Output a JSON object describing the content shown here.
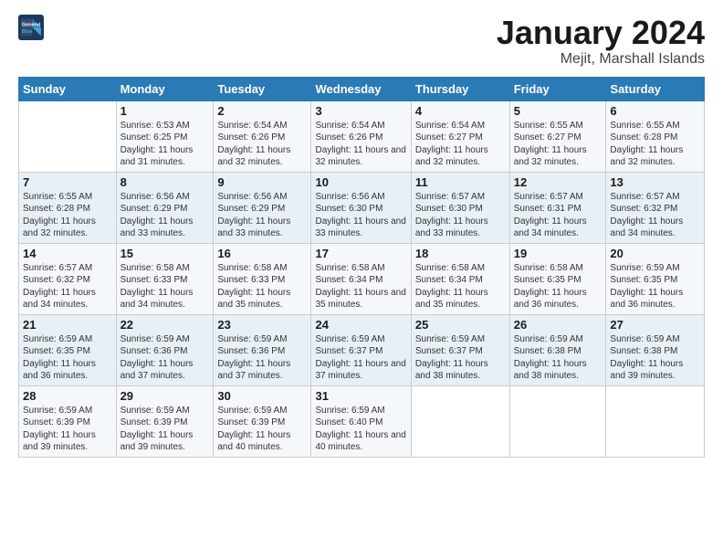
{
  "logo": {
    "line1": "General",
    "line2": "Blue"
  },
  "title": "January 2024",
  "subtitle": "Mejit, Marshall Islands",
  "columns": [
    "Sunday",
    "Monday",
    "Tuesday",
    "Wednesday",
    "Thursday",
    "Friday",
    "Saturday"
  ],
  "weeks": [
    [
      {
        "num": "",
        "sunrise": "",
        "sunset": "",
        "daylight": ""
      },
      {
        "num": "1",
        "sunrise": "Sunrise: 6:53 AM",
        "sunset": "Sunset: 6:25 PM",
        "daylight": "Daylight: 11 hours and 31 minutes."
      },
      {
        "num": "2",
        "sunrise": "Sunrise: 6:54 AM",
        "sunset": "Sunset: 6:26 PM",
        "daylight": "Daylight: 11 hours and 32 minutes."
      },
      {
        "num": "3",
        "sunrise": "Sunrise: 6:54 AM",
        "sunset": "Sunset: 6:26 PM",
        "daylight": "Daylight: 11 hours and 32 minutes."
      },
      {
        "num": "4",
        "sunrise": "Sunrise: 6:54 AM",
        "sunset": "Sunset: 6:27 PM",
        "daylight": "Daylight: 11 hours and 32 minutes."
      },
      {
        "num": "5",
        "sunrise": "Sunrise: 6:55 AM",
        "sunset": "Sunset: 6:27 PM",
        "daylight": "Daylight: 11 hours and 32 minutes."
      },
      {
        "num": "6",
        "sunrise": "Sunrise: 6:55 AM",
        "sunset": "Sunset: 6:28 PM",
        "daylight": "Daylight: 11 hours and 32 minutes."
      }
    ],
    [
      {
        "num": "7",
        "sunrise": "Sunrise: 6:55 AM",
        "sunset": "Sunset: 6:28 PM",
        "daylight": "Daylight: 11 hours and 32 minutes."
      },
      {
        "num": "8",
        "sunrise": "Sunrise: 6:56 AM",
        "sunset": "Sunset: 6:29 PM",
        "daylight": "Daylight: 11 hours and 33 minutes."
      },
      {
        "num": "9",
        "sunrise": "Sunrise: 6:56 AM",
        "sunset": "Sunset: 6:29 PM",
        "daylight": "Daylight: 11 hours and 33 minutes."
      },
      {
        "num": "10",
        "sunrise": "Sunrise: 6:56 AM",
        "sunset": "Sunset: 6:30 PM",
        "daylight": "Daylight: 11 hours and 33 minutes."
      },
      {
        "num": "11",
        "sunrise": "Sunrise: 6:57 AM",
        "sunset": "Sunset: 6:30 PM",
        "daylight": "Daylight: 11 hours and 33 minutes."
      },
      {
        "num": "12",
        "sunrise": "Sunrise: 6:57 AM",
        "sunset": "Sunset: 6:31 PM",
        "daylight": "Daylight: 11 hours and 34 minutes."
      },
      {
        "num": "13",
        "sunrise": "Sunrise: 6:57 AM",
        "sunset": "Sunset: 6:32 PM",
        "daylight": "Daylight: 11 hours and 34 minutes."
      }
    ],
    [
      {
        "num": "14",
        "sunrise": "Sunrise: 6:57 AM",
        "sunset": "Sunset: 6:32 PM",
        "daylight": "Daylight: 11 hours and 34 minutes."
      },
      {
        "num": "15",
        "sunrise": "Sunrise: 6:58 AM",
        "sunset": "Sunset: 6:33 PM",
        "daylight": "Daylight: 11 hours and 34 minutes."
      },
      {
        "num": "16",
        "sunrise": "Sunrise: 6:58 AM",
        "sunset": "Sunset: 6:33 PM",
        "daylight": "Daylight: 11 hours and 35 minutes."
      },
      {
        "num": "17",
        "sunrise": "Sunrise: 6:58 AM",
        "sunset": "Sunset: 6:34 PM",
        "daylight": "Daylight: 11 hours and 35 minutes."
      },
      {
        "num": "18",
        "sunrise": "Sunrise: 6:58 AM",
        "sunset": "Sunset: 6:34 PM",
        "daylight": "Daylight: 11 hours and 35 minutes."
      },
      {
        "num": "19",
        "sunrise": "Sunrise: 6:58 AM",
        "sunset": "Sunset: 6:35 PM",
        "daylight": "Daylight: 11 hours and 36 minutes."
      },
      {
        "num": "20",
        "sunrise": "Sunrise: 6:59 AM",
        "sunset": "Sunset: 6:35 PM",
        "daylight": "Daylight: 11 hours and 36 minutes."
      }
    ],
    [
      {
        "num": "21",
        "sunrise": "Sunrise: 6:59 AM",
        "sunset": "Sunset: 6:35 PM",
        "daylight": "Daylight: 11 hours and 36 minutes."
      },
      {
        "num": "22",
        "sunrise": "Sunrise: 6:59 AM",
        "sunset": "Sunset: 6:36 PM",
        "daylight": "Daylight: 11 hours and 37 minutes."
      },
      {
        "num": "23",
        "sunrise": "Sunrise: 6:59 AM",
        "sunset": "Sunset: 6:36 PM",
        "daylight": "Daylight: 11 hours and 37 minutes."
      },
      {
        "num": "24",
        "sunrise": "Sunrise: 6:59 AM",
        "sunset": "Sunset: 6:37 PM",
        "daylight": "Daylight: 11 hours and 37 minutes."
      },
      {
        "num": "25",
        "sunrise": "Sunrise: 6:59 AM",
        "sunset": "Sunset: 6:37 PM",
        "daylight": "Daylight: 11 hours and 38 minutes."
      },
      {
        "num": "26",
        "sunrise": "Sunrise: 6:59 AM",
        "sunset": "Sunset: 6:38 PM",
        "daylight": "Daylight: 11 hours and 38 minutes."
      },
      {
        "num": "27",
        "sunrise": "Sunrise: 6:59 AM",
        "sunset": "Sunset: 6:38 PM",
        "daylight": "Daylight: 11 hours and 39 minutes."
      }
    ],
    [
      {
        "num": "28",
        "sunrise": "Sunrise: 6:59 AM",
        "sunset": "Sunset: 6:39 PM",
        "daylight": "Daylight: 11 hours and 39 minutes."
      },
      {
        "num": "29",
        "sunrise": "Sunrise: 6:59 AM",
        "sunset": "Sunset: 6:39 PM",
        "daylight": "Daylight: 11 hours and 39 minutes."
      },
      {
        "num": "30",
        "sunrise": "Sunrise: 6:59 AM",
        "sunset": "Sunset: 6:39 PM",
        "daylight": "Daylight: 11 hours and 40 minutes."
      },
      {
        "num": "31",
        "sunrise": "Sunrise: 6:59 AM",
        "sunset": "Sunset: 6:40 PM",
        "daylight": "Daylight: 11 hours and 40 minutes."
      },
      {
        "num": "",
        "sunrise": "",
        "sunset": "",
        "daylight": ""
      },
      {
        "num": "",
        "sunrise": "",
        "sunset": "",
        "daylight": ""
      },
      {
        "num": "",
        "sunrise": "",
        "sunset": "",
        "daylight": ""
      }
    ]
  ]
}
